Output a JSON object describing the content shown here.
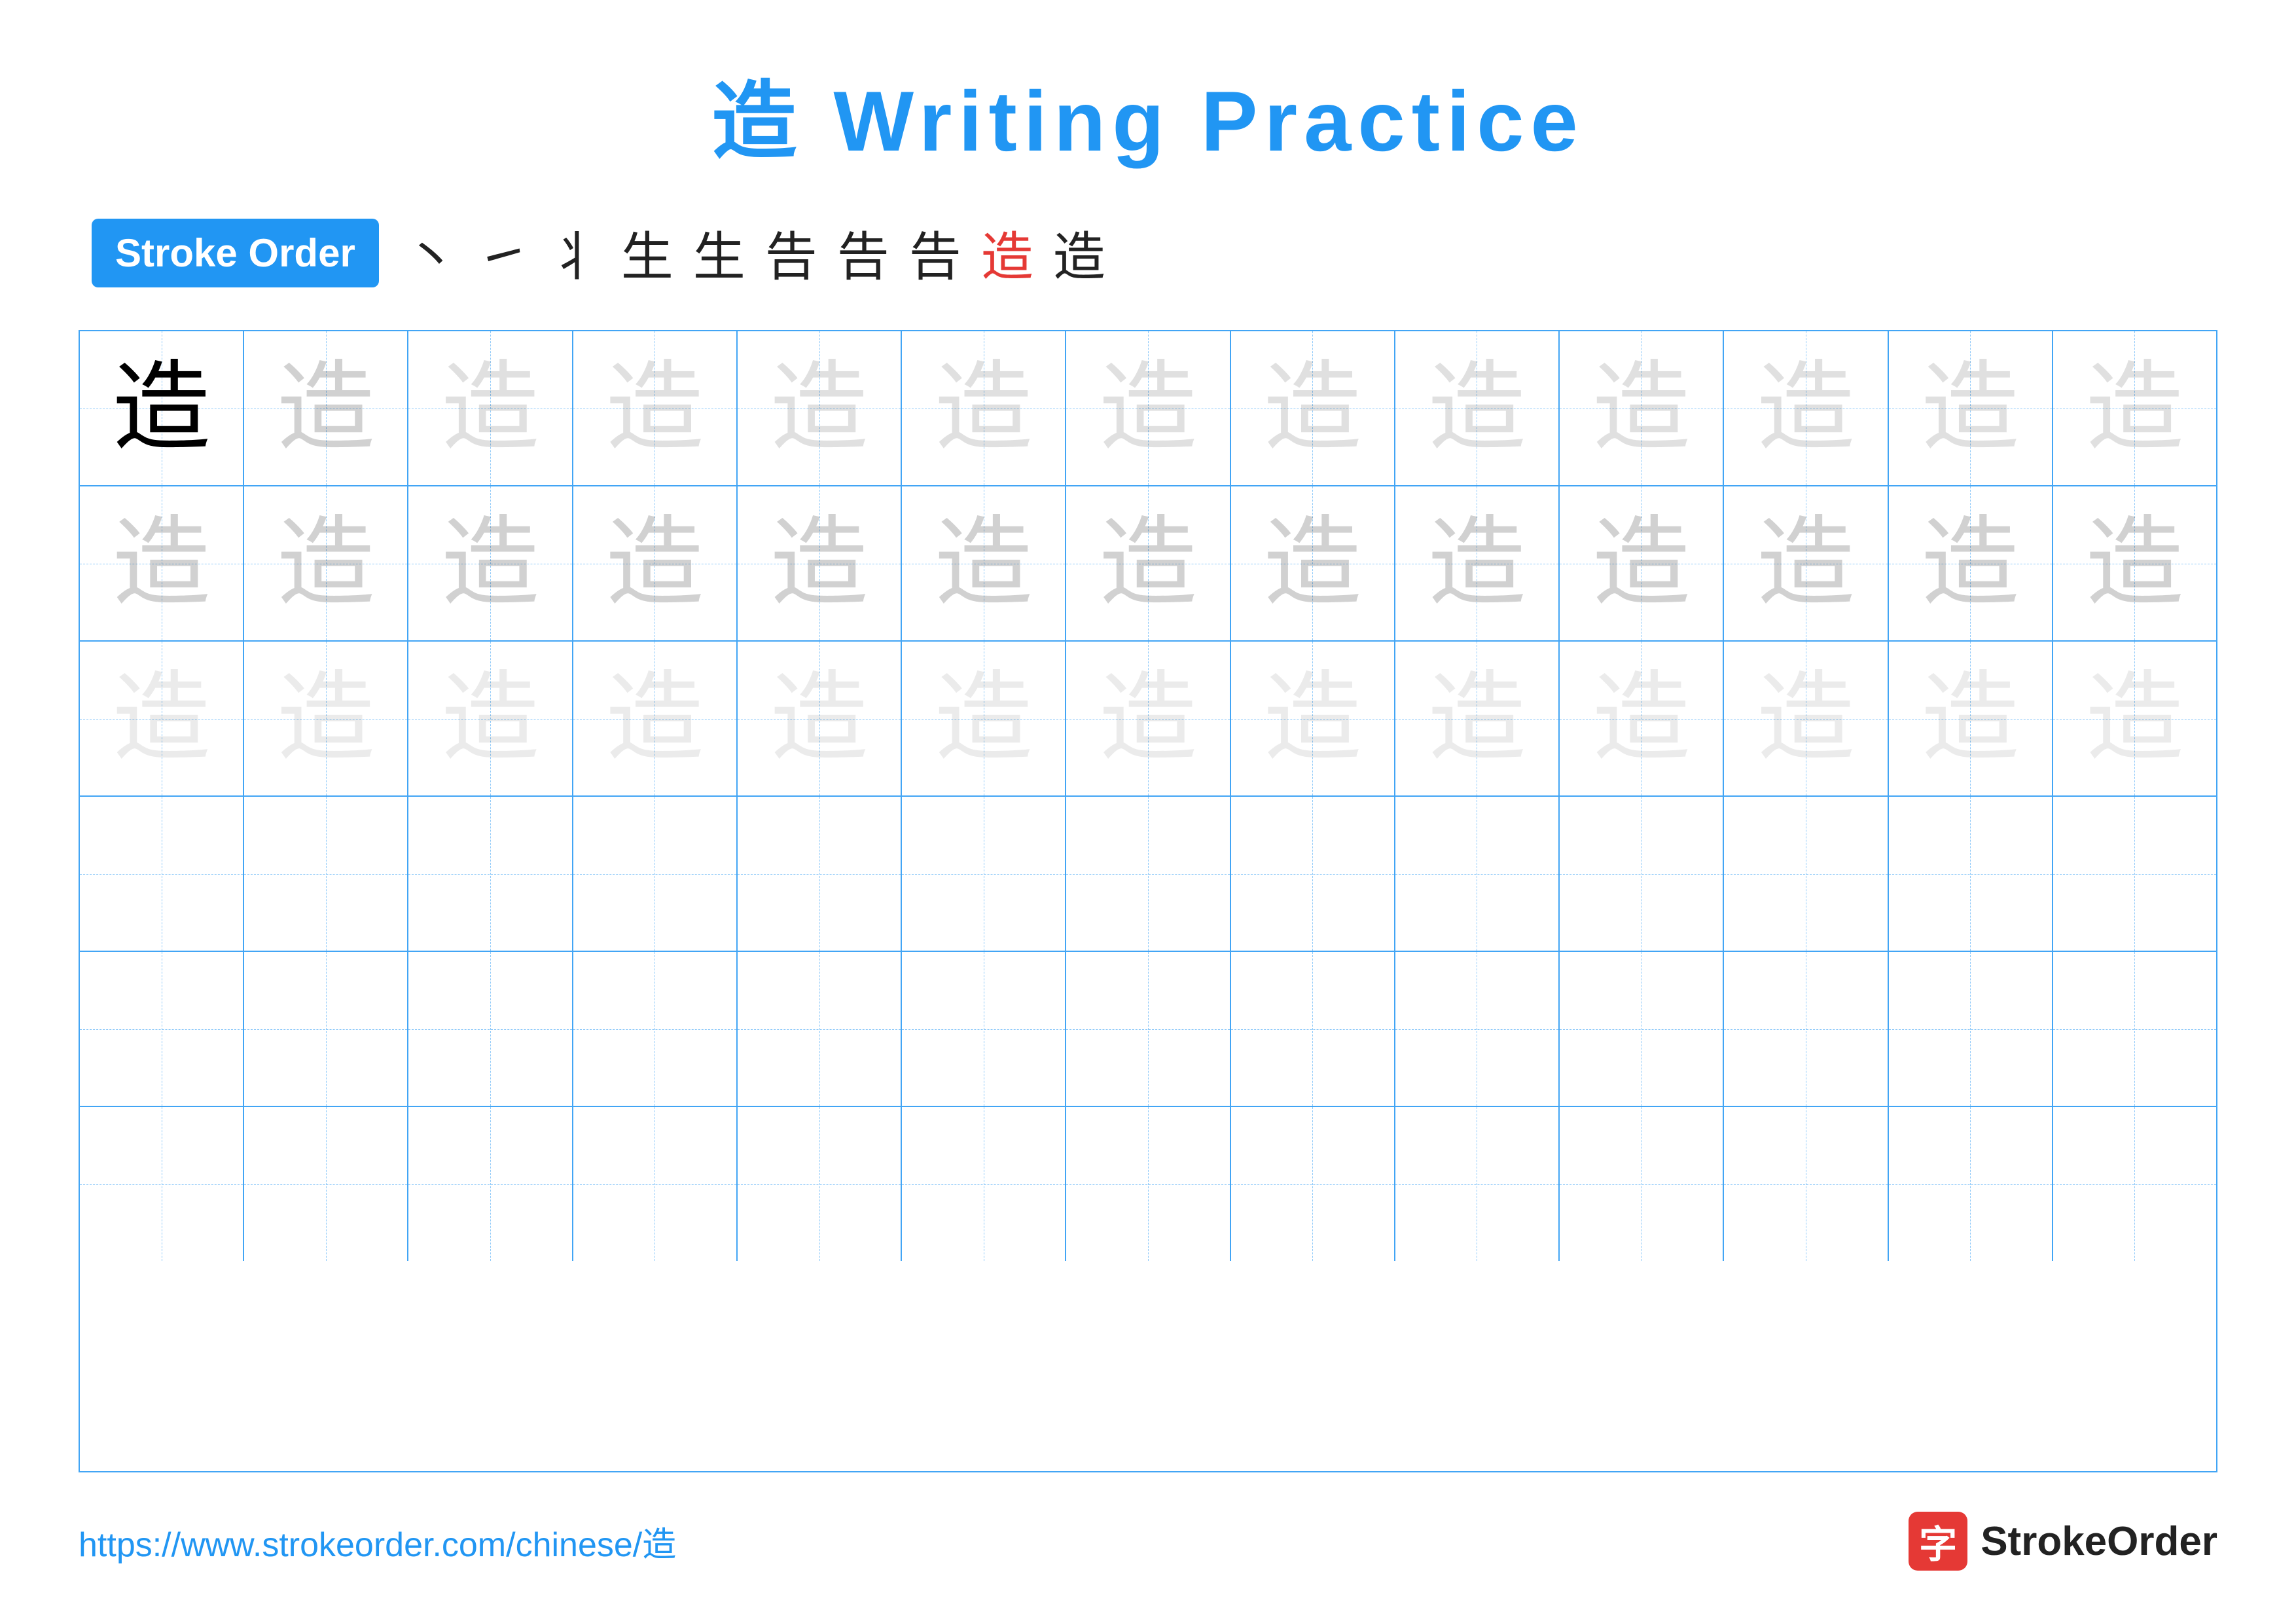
{
  "title": "造 Writing Practice",
  "stroke_order_badge": "Stroke Order",
  "stroke_sequence": [
    "丶",
    "㇀",
    "丬",
    "生",
    "生",
    "告",
    "告",
    "告",
    "造",
    "造"
  ],
  "stroke_seq_red_index": 9,
  "character": "造",
  "grid": {
    "rows": 6,
    "cols": 13
  },
  "footer": {
    "url": "https://www.strokeorder.com/chinese/造",
    "logo_char": "字",
    "logo_name": "StrokeOrder"
  },
  "row_types": [
    "solid",
    "faint1",
    "faint2",
    "empty",
    "empty",
    "empty"
  ],
  "colors": {
    "blue": "#2196F3",
    "red": "#e53935",
    "grid_line": "#42A5F5",
    "dashed": "#90CAF9",
    "faint1": "rgba(0,0,0,0.18)",
    "faint2": "rgba(0,0,0,0.10)"
  }
}
